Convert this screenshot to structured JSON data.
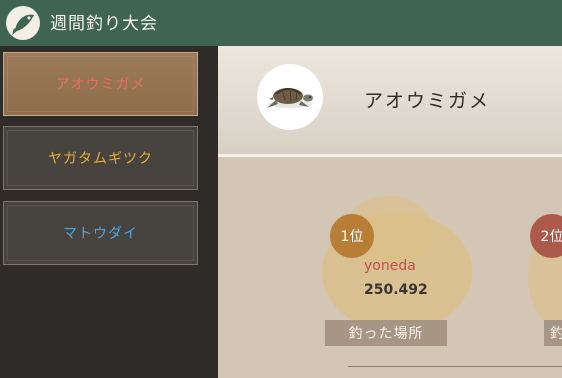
{
  "header": {
    "title": "週間釣り大会"
  },
  "sidebar": {
    "items": [
      {
        "label": "アオウミガメ",
        "color": "#e9705f",
        "active": true
      },
      {
        "label": "ヤガタムギツク",
        "color": "#e6ad39",
        "active": false
      },
      {
        "label": "マトウダイ",
        "color": "#4fa6df",
        "active": false
      }
    ]
  },
  "detail": {
    "fish_name": "アオウミガメ",
    "fish_icon": "sea-turtle-icon",
    "rankings": [
      {
        "rank": "1位",
        "player": "yoneda",
        "score": "250.492",
        "place_label": "釣った場所",
        "badge_color": "#b87e35"
      },
      {
        "rank": "2位",
        "place_label": "釣",
        "badge_color": "#ad5a4c"
      }
    ]
  }
}
